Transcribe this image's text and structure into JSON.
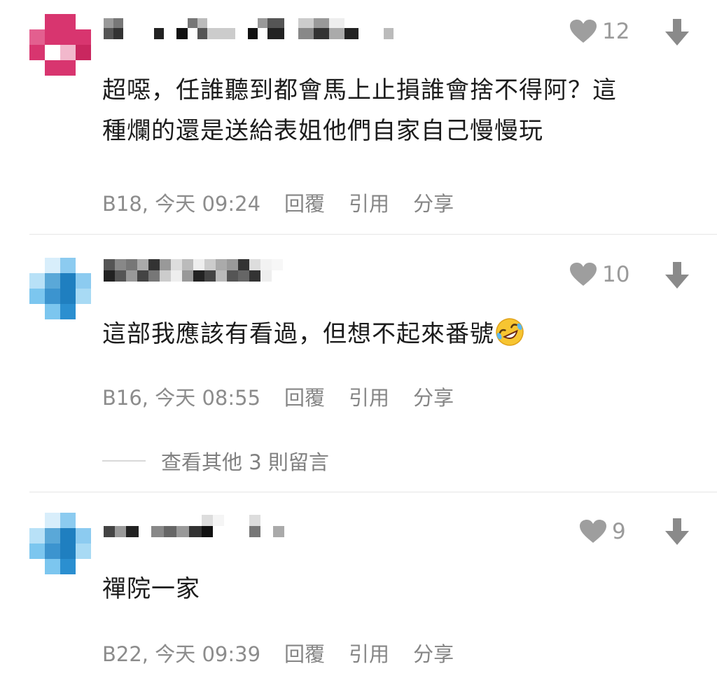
{
  "comments": [
    {
      "likes": "12",
      "text_lines": [
        "超噁，任誰聽到都會馬上止損誰會捨不得阿？這",
        "種爛的還是送給表姐他們自家自己慢慢玩"
      ],
      "timestamp": "B18, 今天 09:24",
      "actions": [
        "回覆",
        "引用",
        "分享"
      ]
    },
    {
      "likes": "10",
      "text_lines": [
        "這部我應該有看過，但想不起來番號"
      ],
      "emoji": "rolling-on-floor-laughing",
      "timestamp": "B16, 今天 08:55",
      "actions": [
        "回覆",
        "引用",
        "分享"
      ],
      "more_replies": "查看其他 3 則留言"
    },
    {
      "likes": "9",
      "text_lines": [
        "禪院一家"
      ],
      "timestamp": "B22, 今天 09:39",
      "actions": [
        "回覆",
        "引用",
        "分享"
      ]
    }
  ],
  "icons": {
    "like": "heart-icon",
    "downvote": "arrow-down-icon"
  },
  "colors": {
    "avatar_pink": "#d8356f",
    "avatar_blue": "#2b8fd0",
    "gray": "#9a9a9a"
  }
}
